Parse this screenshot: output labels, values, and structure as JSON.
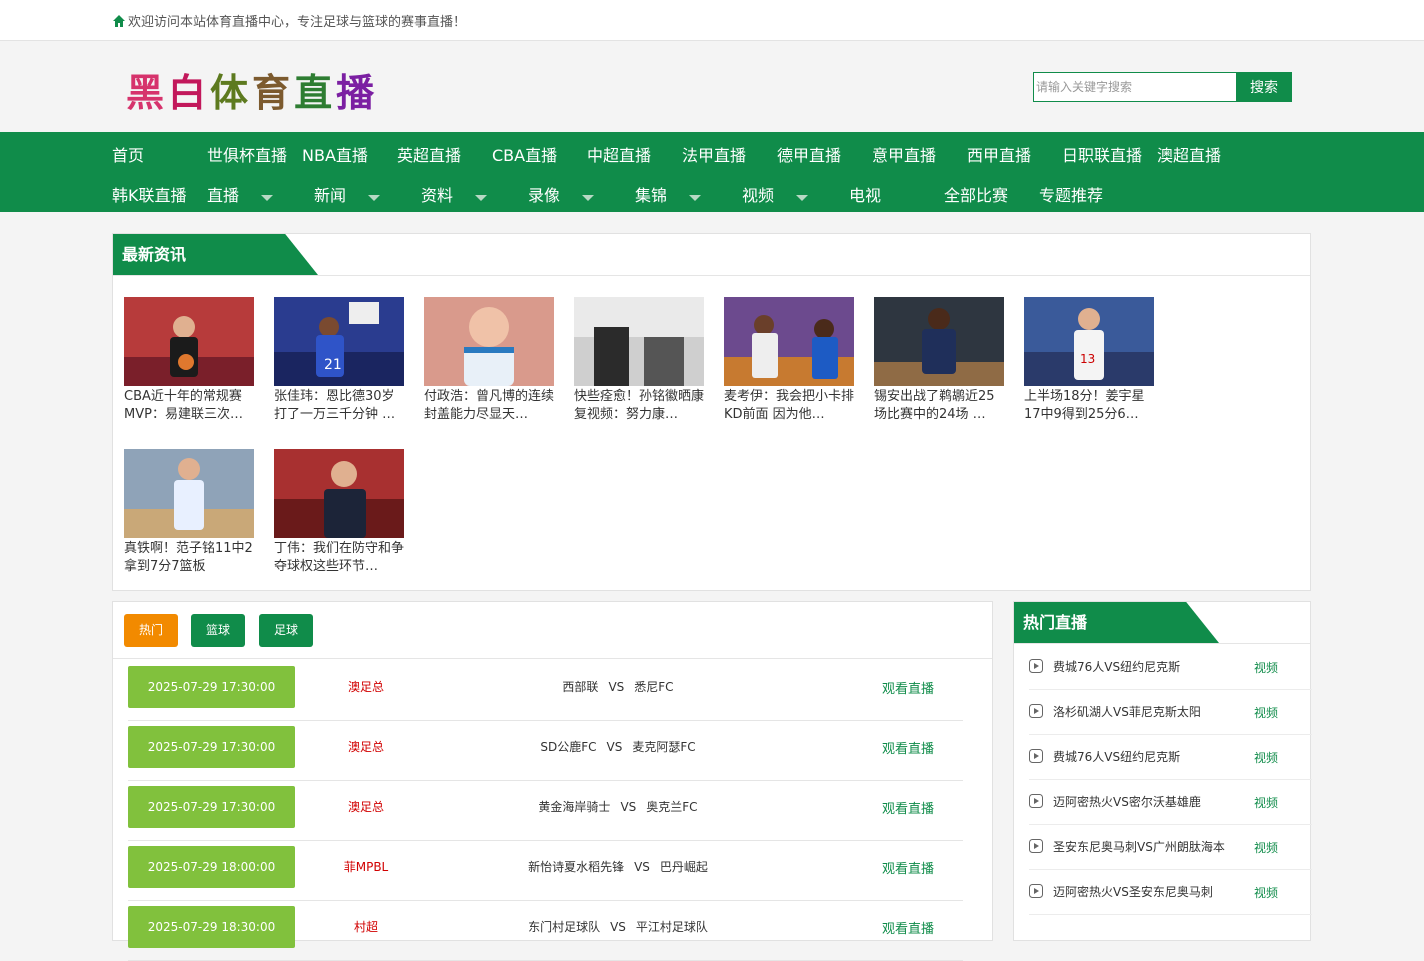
{
  "topbar": {
    "welcome": "欢迎访问本站体育直播中心，专注足球与篮球的赛事直播！"
  },
  "logo": {
    "chars": [
      "黑",
      "白",
      "体",
      "育",
      "直",
      "播"
    ],
    "colors": [
      "#d6336c",
      "#c2185b",
      "#5d7a1f",
      "#7c5a2e",
      "#2e7d32",
      "#7b1fa2"
    ]
  },
  "search": {
    "placeholder": "请输入关键字搜索",
    "button": "搜索"
  },
  "nav_row1": [
    "首页",
    "世俱杯直播",
    "NBA直播",
    "英超直播",
    "CBA直播",
    "中超直播",
    "法甲直播",
    "德甲直播",
    "意甲直播",
    "西甲直播",
    "日职联直播",
    "澳超直播"
  ],
  "nav_row2": [
    {
      "label": "韩K联直播",
      "caret": false
    },
    {
      "label": "直播",
      "caret": true
    },
    {
      "label": "新闻",
      "caret": true
    },
    {
      "label": "资料",
      "caret": true
    },
    {
      "label": "录像",
      "caret": true
    },
    {
      "label": "集锦",
      "caret": true
    },
    {
      "label": "视频",
      "caret": true
    },
    {
      "label": "电视",
      "caret": false
    },
    {
      "label": "全部比赛",
      "caret": false
    },
    {
      "label": "专题推荐",
      "caret": false
    }
  ],
  "news": {
    "title": "最新资讯",
    "items": [
      {
        "caption": "CBA近十年的常规赛MVP：易建联三次…"
      },
      {
        "caption": "张佳玮：恩比德30岁打了一万三千分钟 …"
      },
      {
        "caption": "付政浩：曾凡博的连续封盖能力尽显天…"
      },
      {
        "caption": "快些痊愈！孙铭徽晒康复视频：努力康…"
      },
      {
        "caption": "麦考伊：我会把小卡排KD前面 因为他…"
      },
      {
        "caption": "锡安出战了鹈鹕近25场比赛中的24场 …"
      },
      {
        "caption": "上半场18分！姜宇星17中9得到25分6…"
      },
      {
        "caption": "真铁啊！范子铭11中2拿到7分7篮板"
      },
      {
        "caption": "丁伟：我们在防守和争夺球权这些环节…"
      }
    ]
  },
  "filters": [
    {
      "label": "热门",
      "color": "#f28a00"
    },
    {
      "label": "篮球",
      "color": "#108c4a"
    },
    {
      "label": "足球",
      "color": "#108c4a"
    }
  ],
  "matches": [
    {
      "time": "2025-07-29 17:30:00",
      "league": "澳足总",
      "home": "西部联",
      "vs": "VS",
      "away": "悉尼FC",
      "watch": "观看直播"
    },
    {
      "time": "2025-07-29 17:30:00",
      "league": "澳足总",
      "home": "SD公鹿FC",
      "vs": "VS",
      "away": "麦克阿瑟FC",
      "watch": "观看直播"
    },
    {
      "time": "2025-07-29 17:30:00",
      "league": "澳足总",
      "home": "黄金海岸骑士",
      "vs": "VS",
      "away": "奥克兰FC",
      "watch": "观看直播"
    },
    {
      "time": "2025-07-29 18:00:00",
      "league": "菲MPBL",
      "home": "新怡诗夏水稻先锋",
      "vs": "VS",
      "away": "巴丹崛起",
      "watch": "观看直播"
    },
    {
      "time": "2025-07-29 18:30:00",
      "league": "村超",
      "home": "东门村足球队",
      "vs": "VS",
      "away": "平江村足球队",
      "watch": "观看直播"
    }
  ],
  "hot": {
    "title": "热门直播",
    "items": [
      {
        "name": "费城76人VS纽约尼克斯",
        "link": "视频"
      },
      {
        "name": "洛杉矶湖人VS菲尼克斯太阳",
        "link": "视频"
      },
      {
        "name": "费城76人VS纽约尼克斯",
        "link": "视频"
      },
      {
        "name": "迈阿密热火VS密尔沃基雄鹿",
        "link": "视频"
      },
      {
        "name": "圣安东尼奥马刺VS广州朗肽海本",
        "link": "视频"
      },
      {
        "name": "迈阿密热火VS圣安东尼奥马刺",
        "link": "视频"
      }
    ]
  }
}
